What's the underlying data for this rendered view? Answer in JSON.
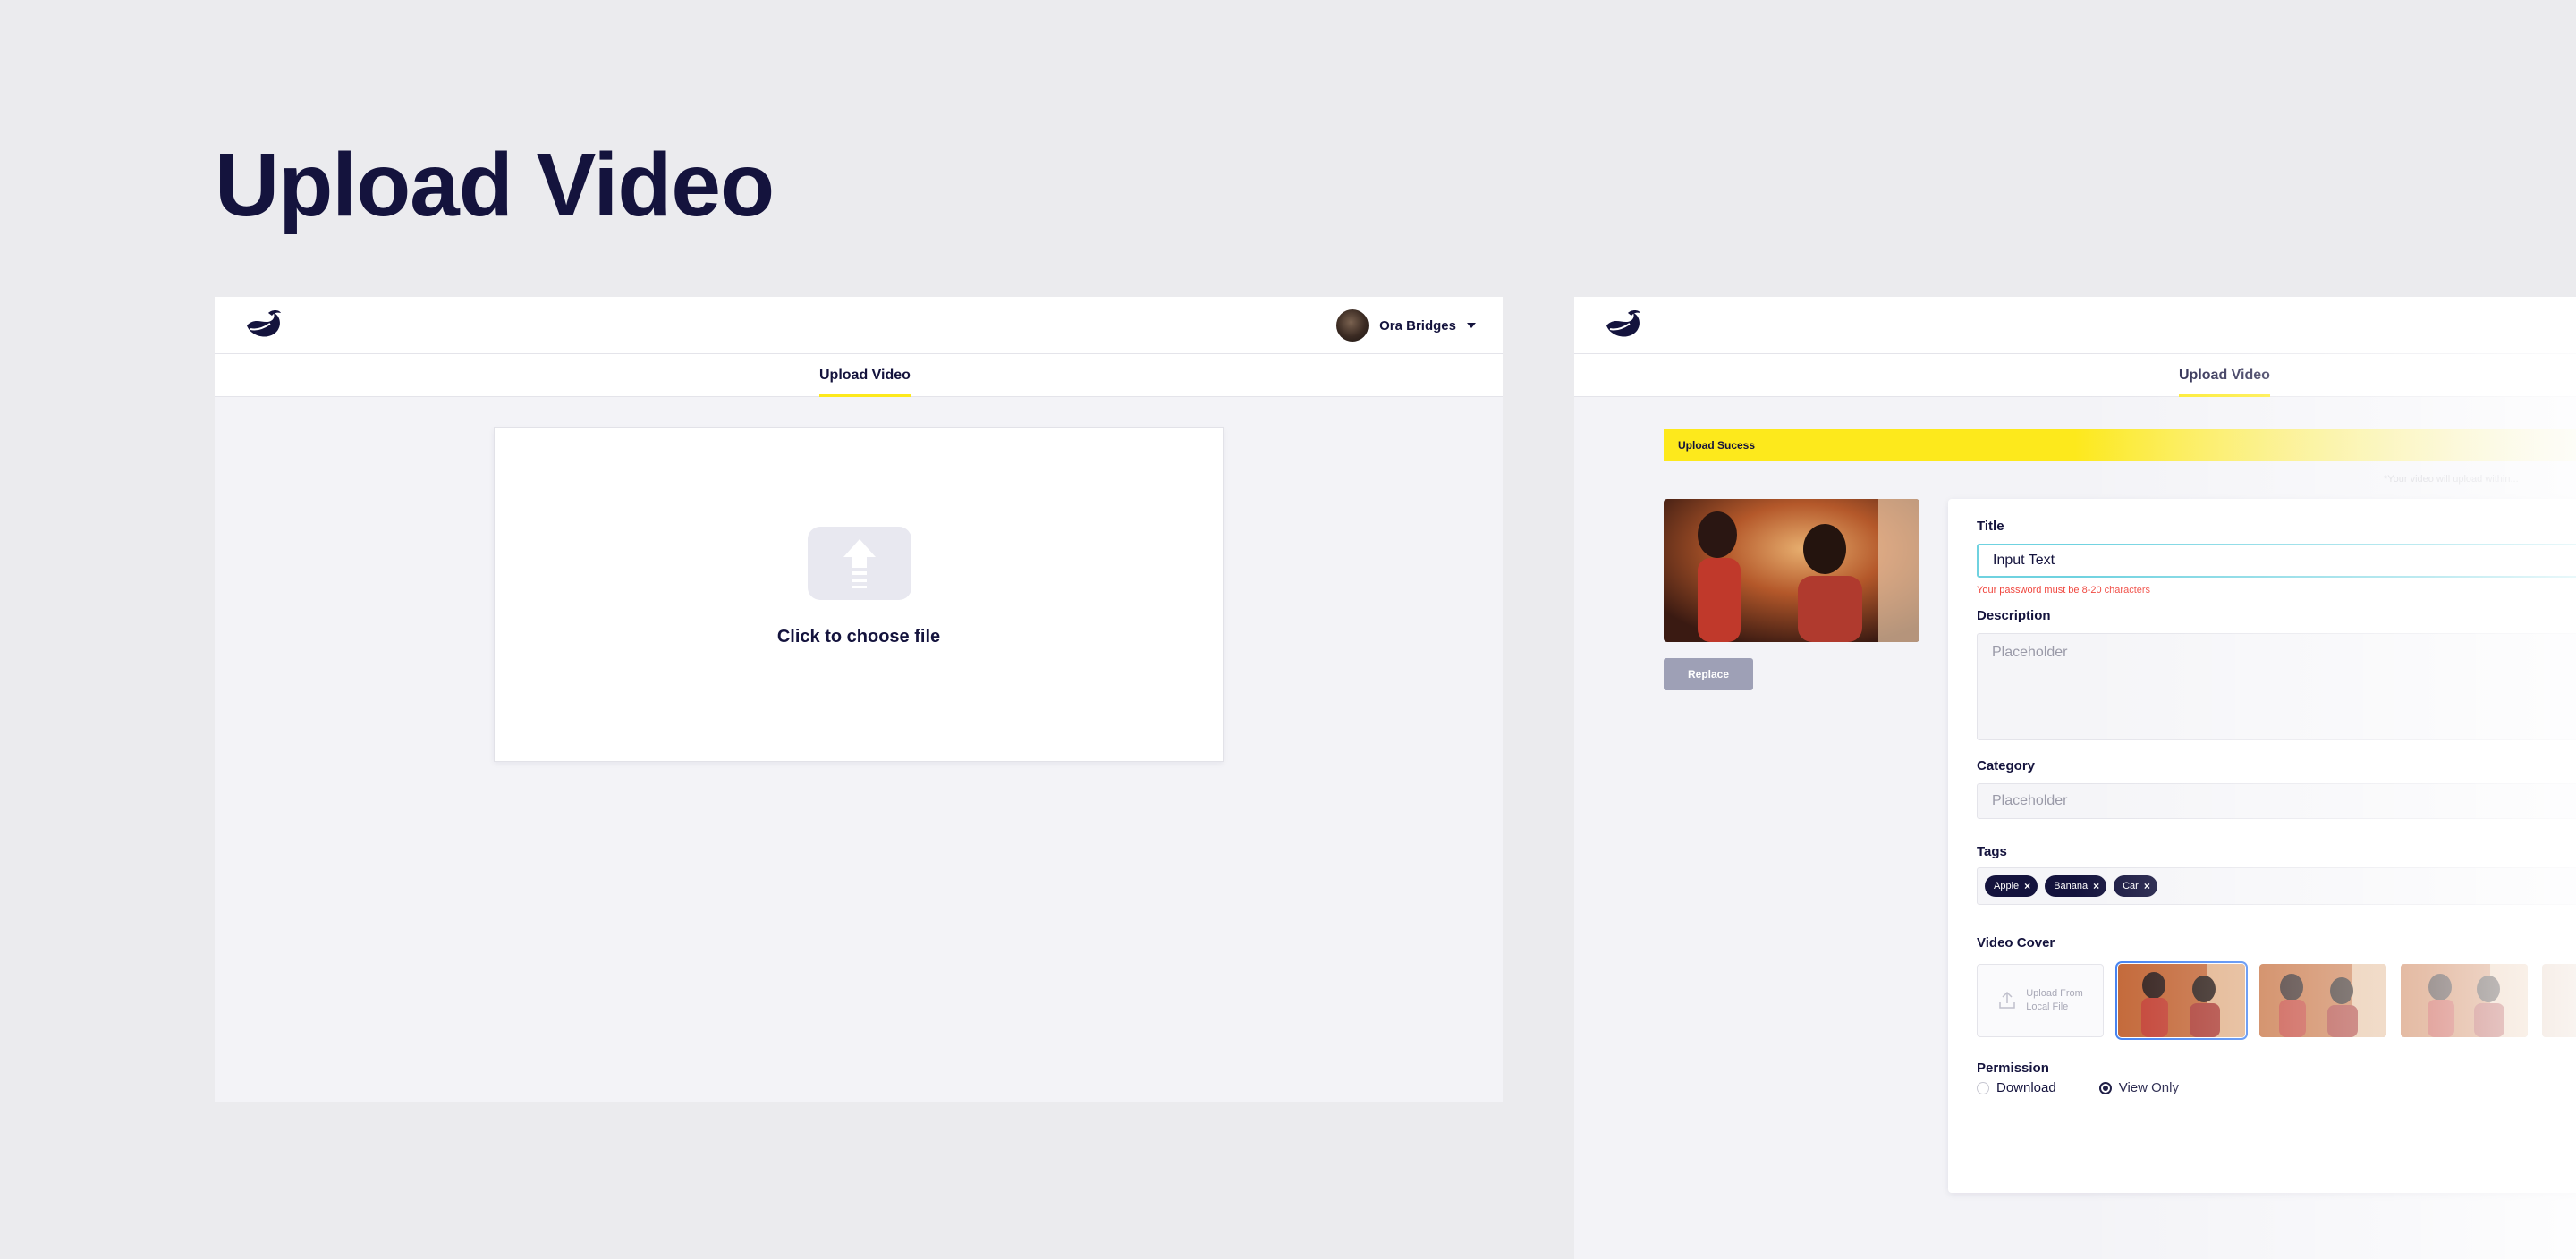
{
  "page": {
    "heading": "Upload Video"
  },
  "panel_upload": {
    "user": {
      "name": "Ora Bridges"
    },
    "tab": "Upload Video",
    "dropzone": {
      "text": "Click to choose file"
    }
  },
  "panel_form": {
    "tab": "Upload Video",
    "banner": "Upload Sucess",
    "hint": "*Your video will upload within...",
    "replace_label": "Replace",
    "title": {
      "label": "Title",
      "value": "Input Text",
      "error": "Your password must be 8-20 characters"
    },
    "description": {
      "label": "Description",
      "placeholder": "Placeholder"
    },
    "category": {
      "label": "Category",
      "placeholder": "Placeholder"
    },
    "tags": {
      "label": "Tags",
      "items": [
        "Apple",
        "Banana",
        "Car"
      ]
    },
    "video_cover": {
      "label": "Video Cover",
      "upload_line1": "Upload From",
      "upload_line2": "Local File",
      "selected_index": 0
    },
    "permission": {
      "label": "Permission",
      "options": [
        "Download",
        "View Only"
      ],
      "selected": "View Only"
    }
  },
  "colors": {
    "brand_navy": "#14133d",
    "accent_yellow": "#fde91c",
    "error_red": "#f0463e",
    "focus_cyan": "#6fd2e0",
    "selected_blue": "#3b7cf0"
  }
}
